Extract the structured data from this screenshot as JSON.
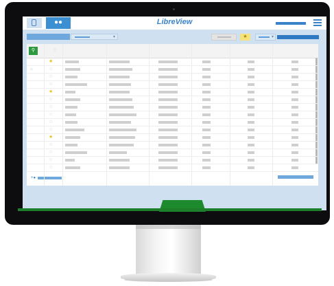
{
  "header": {
    "logo": "LibreView",
    "tabs": [
      {
        "name": "device-icon",
        "active": false
      },
      {
        "name": "patients-icon",
        "active": true
      }
    ]
  },
  "toolbar": {
    "star_button_glyph": "★"
  },
  "table": {
    "header_star": "☆",
    "rows": [
      {
        "starred": true,
        "flag": false
      },
      {
        "starred": false,
        "flag": true
      },
      {
        "starred": false,
        "flag": false
      },
      {
        "starred": false,
        "flag": false
      },
      {
        "starred": true,
        "flag": false
      },
      {
        "starred": false,
        "flag": false
      },
      {
        "starred": false,
        "flag": false
      },
      {
        "starred": false,
        "flag": false
      },
      {
        "starred": false,
        "flag": false
      },
      {
        "starred": false,
        "flag": false
      },
      {
        "starred": true,
        "flag": false
      },
      {
        "starred": false,
        "flag": false
      },
      {
        "starred": false,
        "flag": false
      },
      {
        "starred": false,
        "flag": false
      },
      {
        "starred": false,
        "flag": false
      }
    ]
  },
  "colors": {
    "brand": "#3b83c8",
    "accent_green": "#2e9a3f",
    "star": "#e8c21a",
    "placeholder": "#cfcfcf"
  }
}
